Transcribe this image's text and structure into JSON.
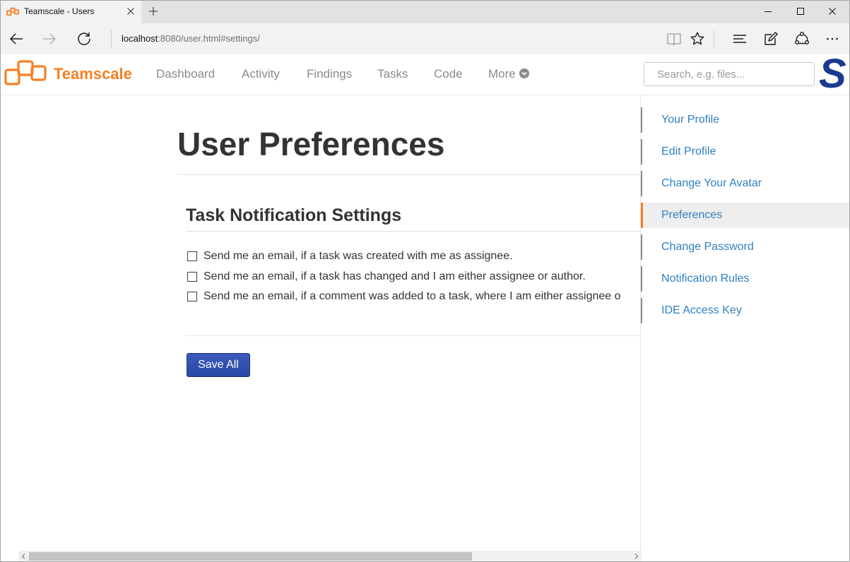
{
  "browser": {
    "tab_title": "Teamscale - Users",
    "address_host": "localhost",
    "address_rest": ":8080/user.html#settings/"
  },
  "header": {
    "logo_text": "Teamscale",
    "nav": [
      {
        "label": "Dashboard"
      },
      {
        "label": "Activity"
      },
      {
        "label": "Findings"
      },
      {
        "label": "Tasks"
      },
      {
        "label": "Code"
      },
      {
        "label": "More"
      }
    ],
    "search_placeholder": "Search, e.g. files...",
    "brand_mark": "S"
  },
  "main": {
    "title": "User Preferences",
    "section_title": "Task Notification Settings",
    "options": [
      {
        "label": "Send me an email, if a task was created with me as assignee.",
        "checked": false
      },
      {
        "label": "Send me an email, if a task has changed and I am either assignee or author.",
        "checked": false
      },
      {
        "label": "Send me an email, if a comment was added to a task, where I am either assignee o",
        "checked": false
      }
    ],
    "save_label": "Save All"
  },
  "sidebar": {
    "items": [
      {
        "label": "Your Profile",
        "active": false
      },
      {
        "label": "Edit Profile",
        "active": false
      },
      {
        "label": "Change Your Avatar",
        "active": false
      },
      {
        "label": "Preferences",
        "active": true
      },
      {
        "label": "Change Password",
        "active": false
      },
      {
        "label": "Notification Rules",
        "active": false
      },
      {
        "label": "IDE Access Key",
        "active": false
      }
    ]
  },
  "scroll": {
    "horizontal": {
      "position": 0,
      "visible_fraction": 0.736
    }
  },
  "icons": {
    "tab": [
      "teamscale-favicon-icon",
      "close-icon",
      "plus-icon"
    ],
    "window": [
      "minimize-icon",
      "maximize-icon",
      "close-icon"
    ],
    "toolbar": [
      "back-arrow-icon",
      "forward-arrow-icon",
      "refresh-icon",
      "reading-view-icon",
      "star-icon",
      "hub-icon",
      "web-note-icon",
      "share-icon",
      "more-dots-icon"
    ],
    "nav": [
      "teamscale-logo-icon",
      "chevron-circle-down-icon"
    ]
  },
  "colors": {
    "brand_orange": "#f58025",
    "link_blue": "#2f80c1",
    "button_blue": "#2a48a3",
    "brand_navy": "#1a3b8f"
  }
}
